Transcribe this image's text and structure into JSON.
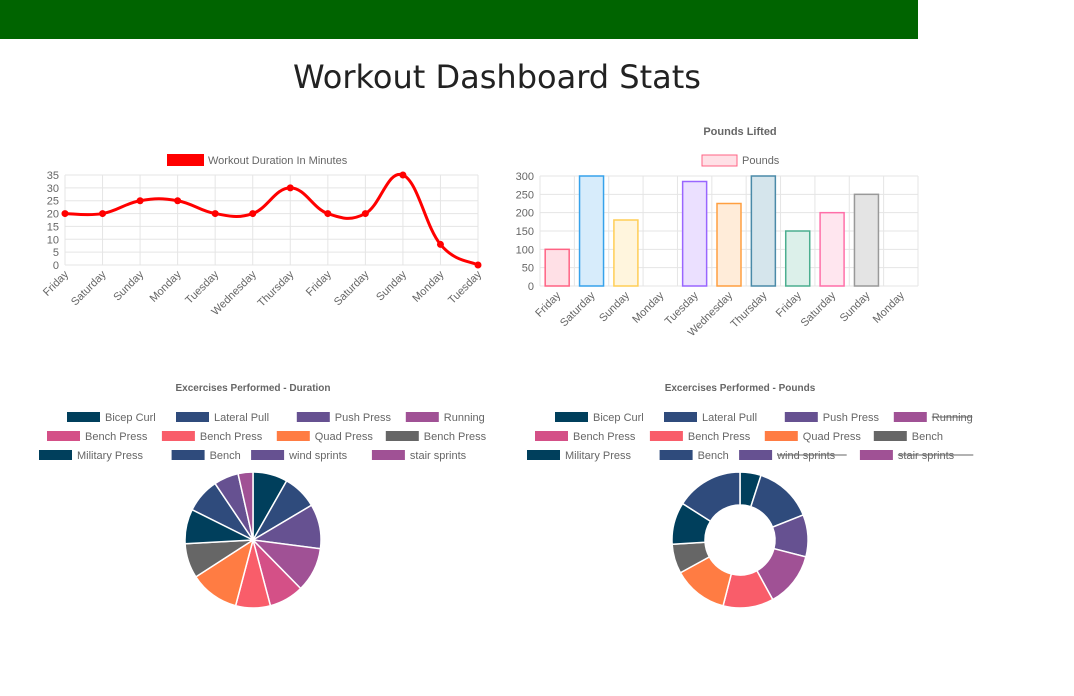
{
  "page": {
    "title": "Workout Dashboard Stats",
    "header_color": "#006400"
  },
  "chart_data": [
    {
      "type": "line",
      "title": "",
      "legend": "Workout Duration In Minutes",
      "legend_color": "#ff0000",
      "categories": [
        "Friday",
        "Saturday",
        "Sunday",
        "Monday",
        "Tuesday",
        "Wednesday",
        "Thursday",
        "Friday",
        "Saturday",
        "Sunday",
        "Monday",
        "Tuesday"
      ],
      "series": [
        {
          "name": "Workout Duration In Minutes",
          "values": [
            20,
            20,
            25,
            25,
            20,
            20,
            30,
            20,
            20,
            35,
            8,
            0
          ],
          "color": "#ff0000"
        }
      ],
      "ylim": [
        0,
        35
      ],
      "yticks": [
        0,
        5,
        10,
        15,
        20,
        25,
        30,
        35
      ],
      "grid": true
    },
    {
      "type": "bar",
      "title": "Pounds Lifted",
      "legend": "Pounds",
      "categories": [
        "Friday",
        "Saturday",
        "Sunday",
        "Monday",
        "Tuesday",
        "Wednesday",
        "Thursday",
        "Friday",
        "Saturday",
        "Sunday",
        "Monday"
      ],
      "series": [
        {
          "name": "Pounds",
          "values": [
            100,
            300,
            180,
            0,
            285,
            225,
            300,
            150,
            200,
            250,
            0
          ]
        }
      ],
      "bar_fills": [
        "#ffe0e6",
        "#d7ecfb",
        "#fff5dd",
        "#ffffff",
        "#ebe0ff",
        "#ffecd9",
        "#d5e5ec",
        "#dcf0ea",
        "#ffe6ef",
        "#e4e4e4",
        "#ffffff"
      ],
      "bar_strokes": [
        "#ff6384",
        "#36a2eb",
        "#ffce56",
        "#ffffff",
        "#9966ff",
        "#ff9f40",
        "#4a8aa8",
        "#4bae8f",
        "#ff6fa8",
        "#999999",
        "#ffffff"
      ],
      "ylim": [
        0,
        300
      ],
      "yticks": [
        0,
        50,
        100,
        150,
        200,
        250,
        300
      ],
      "grid": true
    },
    {
      "type": "pie",
      "title": "Excercises Performed - Duration",
      "labels": [
        "Bicep Curl",
        "Lateral Pull",
        "Push Press",
        "Running",
        "Bench Press",
        "Bench Press",
        "Quad Press",
        "Bench Press",
        "Military Press",
        "Bench",
        "wind sprints",
        "stair sprints",
        ""
      ],
      "values": [
        7,
        7,
        9,
        9,
        7,
        7,
        10,
        7,
        7,
        7,
        5,
        3,
        0
      ],
      "colors": [
        "#003f5c",
        "#2f4b7c",
        "#665191",
        "#a05195",
        "#d45087",
        "#f95d6a",
        "#ff7c43",
        "#666666",
        "#003f5c",
        "#2f4b7c",
        "#665191",
        "#a05195",
        "#d45087"
      ],
      "hidden": []
    },
    {
      "type": "pie",
      "title": "Excercises Performed - Pounds",
      "labels": [
        "Bicep Curl",
        "Lateral Pull",
        "Push Press",
        "Running",
        "Bench Press",
        "Bench Press",
        "Quad Press",
        "Bench",
        "Military Press",
        "Bench",
        "wind sprints",
        "stair sprints",
        ""
      ],
      "values": [
        5,
        14,
        10,
        13,
        0,
        12,
        13,
        7,
        10,
        16,
        0,
        0,
        0
      ],
      "colors": [
        "#003f5c",
        "#2f4b7c",
        "#665191",
        "#a05195",
        "#d45087",
        "#f95d6a",
        "#ff7c43",
        "#666666",
        "#003f5c",
        "#2f4b7c",
        "#665191",
        "#a05195",
        "#d45087"
      ],
      "hidden": [
        3,
        10,
        11
      ]
    }
  ]
}
